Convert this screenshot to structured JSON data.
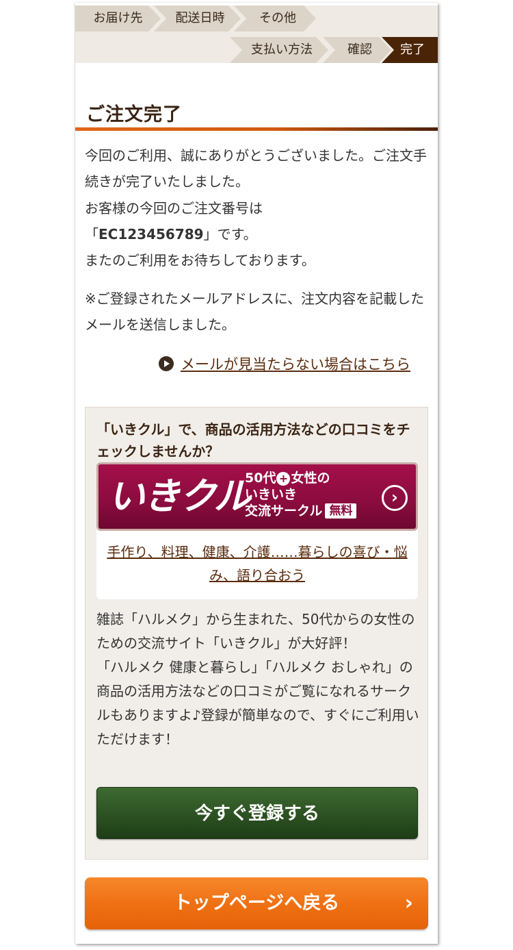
{
  "steps": {
    "row1": [
      "お届け先",
      "配送日時",
      "その他"
    ],
    "row2": [
      "支払い方法",
      "確認",
      "完了"
    ],
    "active": "完了"
  },
  "heading": "ご注文完了",
  "message": {
    "line1": "今回のご利用、誠にありがとうございました。ご注文手続きが完了いたしました。",
    "line2_prefix": "お客様の今回のご注文番号は",
    "order_open": "「",
    "order_number": "EC123456789",
    "order_close": "」です。",
    "line3": "またのご利用をお待ちしております。",
    "notice": "※ご登録されたメールアドレスに、注文内容を記載したメールを送信しました。"
  },
  "mail_link": "メールが見当たらない場合はこちら",
  "promo": {
    "title": "「いきクル」で、商品の活用方法などの口コミをチェックしませんか？",
    "banner_logo": "いきクル",
    "banner_sub1_a": "50代",
    "banner_sub1_plus": "+",
    "banner_sub1_b": "女性の",
    "banner_sub2": "いきいき",
    "banner_sub3": "交流サークル",
    "banner_badge": "無料",
    "banner_arrow": "›",
    "link": "手作り、料理、健康、介護……暮らしの喜び・悩み、語り合おう",
    "desc1": "雑誌「ハルメク」から生まれた、50代からの女性のための交流サイト「いきクル」が大好評！",
    "desc2": "「ハルメク 健康と暮らし」「ハルメク おしゃれ」の商品の活用方法などの口コミがご覧になれるサークルもありますよ♪登録が簡単なので、すぐにご利用いただけます！",
    "register_label": "今すぐ登録する"
  },
  "top_button": {
    "label": "トップページへ戻る",
    "chevron": "›"
  },
  "colors": {
    "accent_orange": "#ee6f12",
    "step_active": "#4a2406",
    "banner": "#8a0c3d",
    "register_green": "#2c5122"
  }
}
